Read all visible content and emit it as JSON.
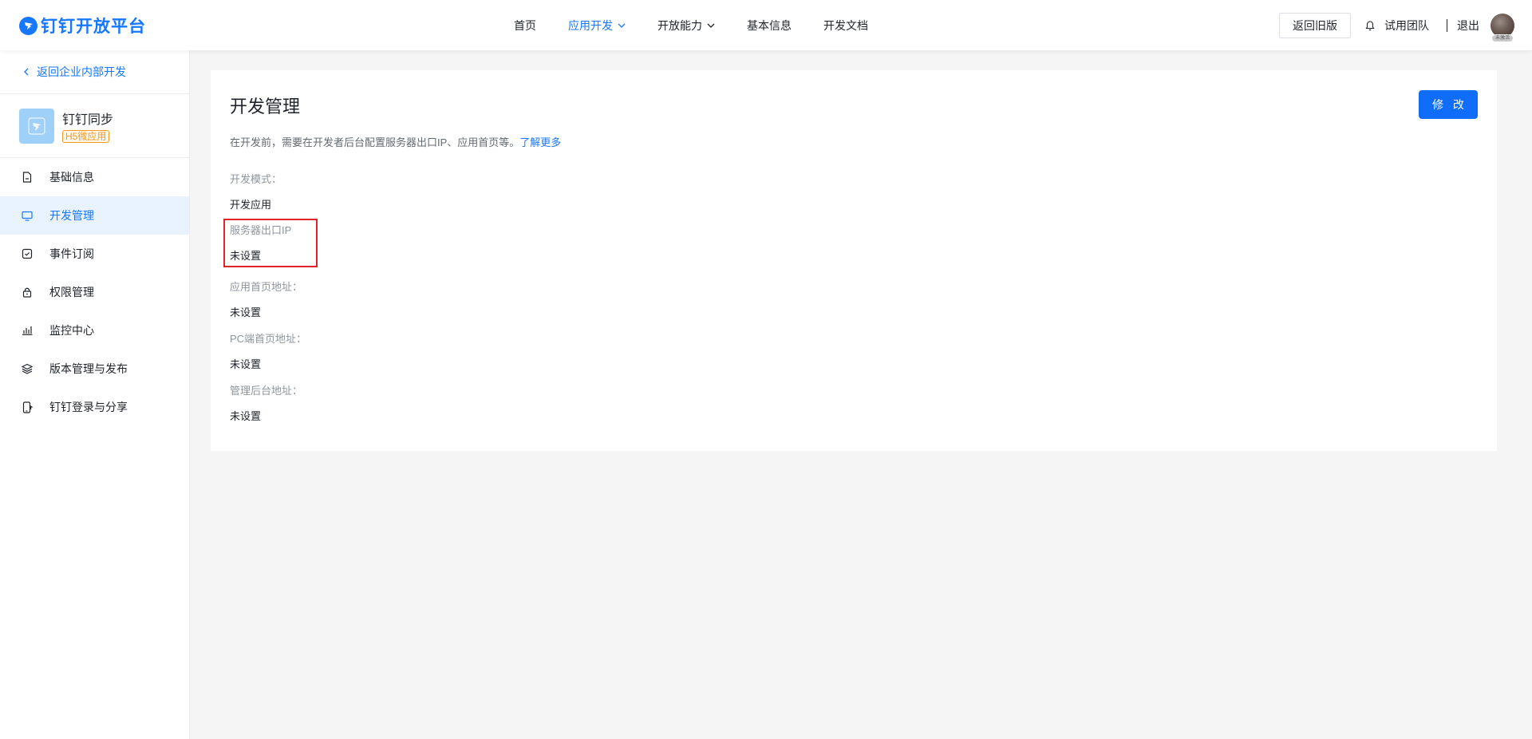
{
  "header": {
    "brand": "钉钉开放平台",
    "nav": [
      {
        "label": "首页",
        "active": false,
        "dropdown": false
      },
      {
        "label": "应用开发",
        "active": true,
        "dropdown": true
      },
      {
        "label": "开放能力",
        "active": false,
        "dropdown": true
      },
      {
        "label": "基本信息",
        "active": false,
        "dropdown": false
      },
      {
        "label": "开发文档",
        "active": false,
        "dropdown": false
      }
    ],
    "old_version_button": "返回旧版",
    "team": "试用团队",
    "logout": "退出",
    "avatar_tag": "未激活"
  },
  "sidebar": {
    "back": "返回企业内部开发",
    "app_name": "钉钉同步",
    "app_tag": "H5微应用",
    "items": [
      {
        "label": "基础信息",
        "icon": "document-icon",
        "active": false
      },
      {
        "label": "开发管理",
        "icon": "monitor-icon",
        "active": true
      },
      {
        "label": "事件订阅",
        "icon": "calendar-check-icon",
        "active": false
      },
      {
        "label": "权限管理",
        "icon": "lock-icon",
        "active": false
      },
      {
        "label": "监控中心",
        "icon": "bar-chart-icon",
        "active": false
      },
      {
        "label": "版本管理与发布",
        "icon": "layers-icon",
        "active": false
      },
      {
        "label": "钉钉登录与分享",
        "icon": "phone-share-icon",
        "active": false
      }
    ]
  },
  "main": {
    "title": "开发管理",
    "edit_button": "修 改",
    "description": "在开发前，需要在开发者后台配置服务器出口IP、应用首页等。",
    "learn_more": "了解更多",
    "fields": [
      {
        "label": "开发模式：",
        "value": "开发应用"
      },
      {
        "label": "服务器出口IP",
        "value": "未设置"
      },
      {
        "label": "应用首页地址：",
        "value": "未设置"
      },
      {
        "label": "PC端首页地址：",
        "value": "未设置"
      },
      {
        "label": "管理后台地址：",
        "value": "未设置"
      }
    ]
  },
  "colors": {
    "primary": "#1677ff",
    "button": "#0f6dfa",
    "highlight": "#e5212a",
    "tag": "#f59a23"
  }
}
